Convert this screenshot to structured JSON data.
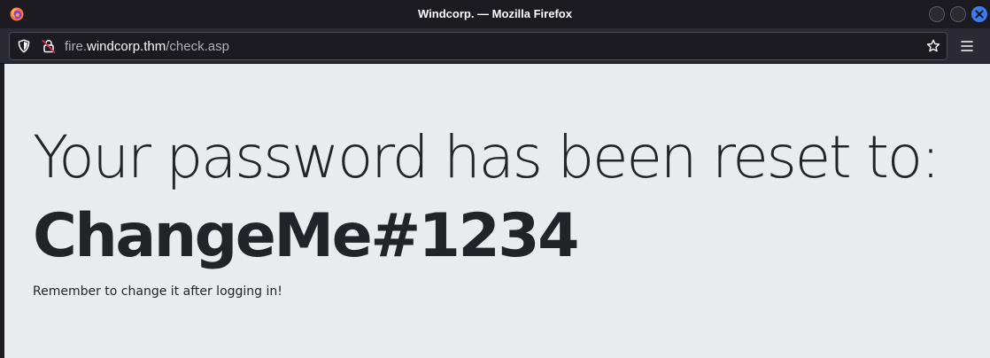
{
  "window": {
    "title": "Windcorp. — Mozilla Firefox",
    "icon": "firefox-logo-icon",
    "controls": [
      "minimize-icon",
      "maximize-icon",
      "close-icon"
    ]
  },
  "toolbar": {
    "url": {
      "subdomain": "fire.",
      "domain": "windcorp.thm",
      "path": "/check.asp"
    },
    "icons": [
      "shield-icon",
      "insecure-lock-icon",
      "bookmark-star-icon",
      "hamburger-menu-icon"
    ]
  },
  "page": {
    "heading": "Your password has been reset to:",
    "password": "ChangeMe#1234",
    "note": "Remember to change it after logging in!"
  },
  "colors": {
    "chrome_bg": "#1c1b22",
    "toolbar_bg": "#2b2a33",
    "page_bg": "#e9ecef",
    "text": "#212529",
    "close_button": "#3d7bf0"
  }
}
